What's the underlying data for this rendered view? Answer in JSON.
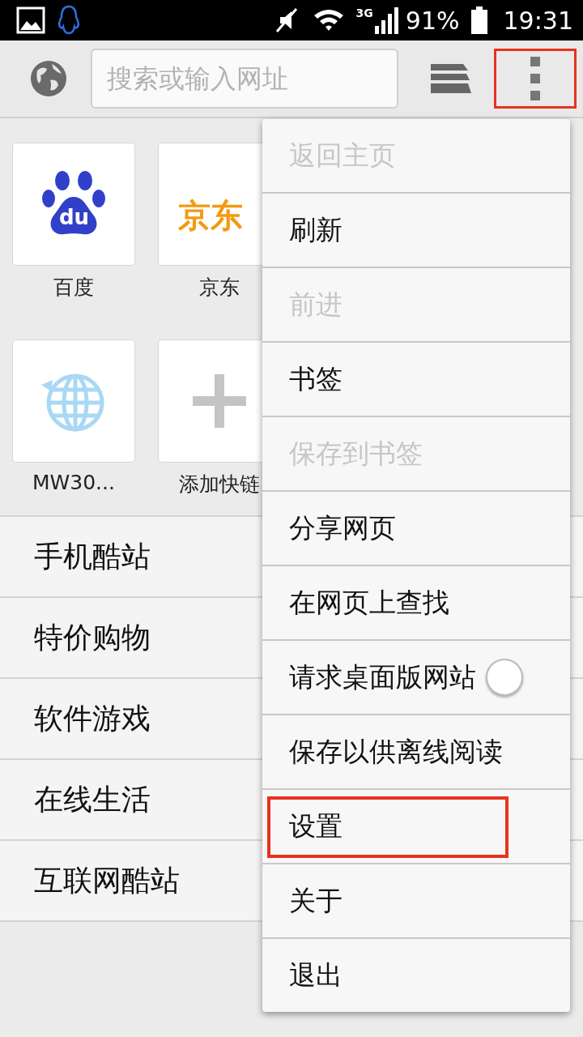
{
  "status_bar": {
    "network": "3G",
    "battery": "91%",
    "time": "19:31"
  },
  "toolbar": {
    "search": {
      "placeholder": "搜索或输入网址"
    },
    "menu_button": {
      "highlighted": true
    }
  },
  "tiles": [
    {
      "kind": "paw",
      "logo_text": "du",
      "label": "百度"
    },
    {
      "kind": "wordmark",
      "logo_text": "京东",
      "label": "京东"
    },
    {
      "kind": "globe",
      "label": "MW30..."
    },
    {
      "kind": "add",
      "label": "添加快链"
    }
  ],
  "categories": [
    "手机酷站",
    "特价购物",
    "软件游戏",
    "在线生活",
    "互联网酷站"
  ],
  "menu": {
    "items": [
      {
        "kind": "plain",
        "label": "返回主页",
        "disabled": true,
        "highlighted": false
      },
      {
        "kind": "plain",
        "label": "刷新",
        "disabled": false,
        "highlighted": false
      },
      {
        "kind": "plain",
        "label": "前进",
        "disabled": true,
        "highlighted": false
      },
      {
        "kind": "plain",
        "label": "书签",
        "disabled": false,
        "highlighted": false
      },
      {
        "kind": "plain",
        "label": "保存到书签",
        "disabled": true,
        "highlighted": false
      },
      {
        "kind": "plain",
        "label": "分享网页",
        "disabled": false,
        "highlighted": false
      },
      {
        "kind": "plain",
        "label": "在网页上查找",
        "disabled": false,
        "highlighted": false
      },
      {
        "kind": "toggle",
        "label": "请求桌面版网站",
        "disabled": false,
        "highlighted": false,
        "on": false
      },
      {
        "kind": "plain",
        "label": "保存以供离线阅读",
        "disabled": false,
        "highlighted": false
      },
      {
        "kind": "plain",
        "label": "设置",
        "disabled": false,
        "highlighted": true
      },
      {
        "kind": "plain",
        "label": "关于",
        "disabled": false,
        "highlighted": false
      },
      {
        "kind": "plain",
        "label": "退出",
        "disabled": false,
        "highlighted": false
      }
    ]
  }
}
